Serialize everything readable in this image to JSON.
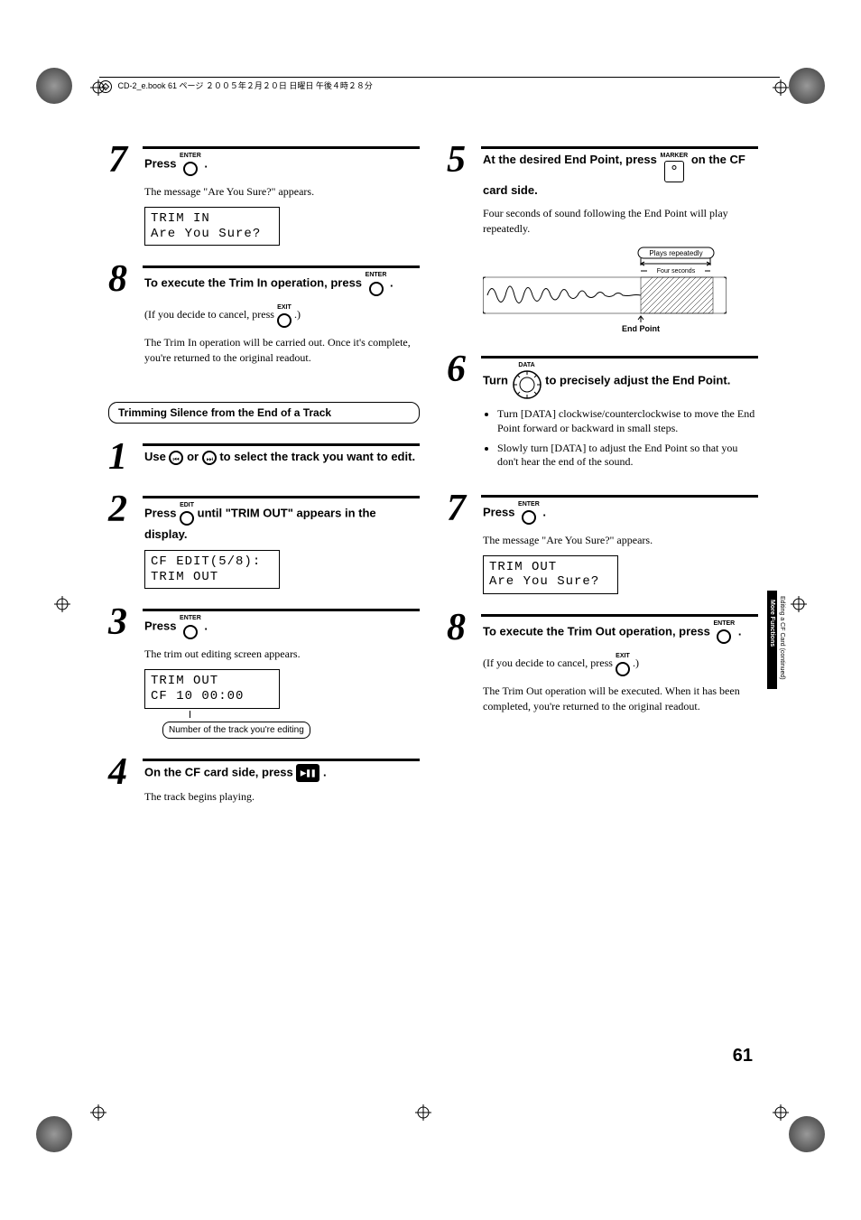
{
  "header": "CD-2_e.book 61 ページ ２００５年２月２０日 日曜日 午後４時２８分",
  "left": {
    "step7": {
      "num": "7",
      "instr_a": "Press ",
      "instr_b": " .",
      "btn_top": "ENTER",
      "msg": "The message \"Are You Sure?\" appears.",
      "lcd1": "TRIM IN",
      "lcd2": "Are You Sure?"
    },
    "step8": {
      "num": "8",
      "instr": "To execute the Trim In operation, press ",
      "instr_b": " .",
      "btn_top": "ENTER",
      "cancel_a": "(If you decide to cancel, press ",
      "cancel_b": " .)",
      "cancel_btn_top": "EXIT",
      "result": "The Trim In operation will be carried out. Once it's complete, you're returned to the original readout."
    },
    "heading": "Trimming Silence from the End of a Track",
    "b_step1": {
      "num": "1",
      "instr_a": "Use ",
      "instr_b": " or ",
      "instr_c": " to select the track you want to edit."
    },
    "b_step2": {
      "num": "2",
      "instr_a": "Press ",
      "instr_b": " until \"TRIM OUT\" appears in the display.",
      "btn_top": "EDIT",
      "lcd1": "CF EDIT(5/8):",
      "lcd2": "TRIM OUT"
    },
    "b_step3": {
      "num": "3",
      "instr_a": "Press ",
      "instr_b": " .",
      "btn_top": "ENTER",
      "msg": "The trim out editing screen appears.",
      "lcd1": "TRIM OUT",
      "lcd2": "CF  10  00:00",
      "callout": "Number of the track you're editing"
    },
    "b_step4": {
      "num": "4",
      "instr_a": "On the CF card side, press ",
      "instr_b": " .",
      "msg": "The track begins playing."
    }
  },
  "right": {
    "step5": {
      "num": "5",
      "instr_a": "At the desired End Point, press ",
      "instr_b": " on the CF card side.",
      "btn_top": "MARKER",
      "msg": "Four seconds of sound following the End Point will play repeatedly.",
      "wave_label1": "Plays repeatedly",
      "wave_label2": "Four seconds",
      "wave_label3": "End Point"
    },
    "step6": {
      "num": "6",
      "instr_a": "Turn ",
      "instr_b": " to precisely adjust the End Point.",
      "btn_top": "DATA",
      "bullet1": "Turn [DATA] clockwise/counterclockwise to move the End Point forward or backward in small steps.",
      "bullet2": "Slowly turn [DATA] to adjust the End Point so that you don't hear the end of the sound."
    },
    "step7": {
      "num": "7",
      "instr_a": "Press ",
      "instr_b": " .",
      "btn_top": "ENTER",
      "msg": "The message \"Are You Sure?\" appears.",
      "lcd1": "TRIM OUT",
      "lcd2": "Are You Sure?"
    },
    "step8": {
      "num": "8",
      "instr": "To execute the Trim Out operation, press ",
      "instr_b": " .",
      "btn_top": "ENTER",
      "cancel_a": "(If you decide to cancel, press ",
      "cancel_b": " .)",
      "cancel_btn_top": "EXIT",
      "result": "The Trim Out operation will be executed. When it has been completed, you're returned to the original readout."
    }
  },
  "pagenum": "61",
  "side_tab1": "Editing a CF Card (continued)",
  "side_tab2": "More Functions"
}
